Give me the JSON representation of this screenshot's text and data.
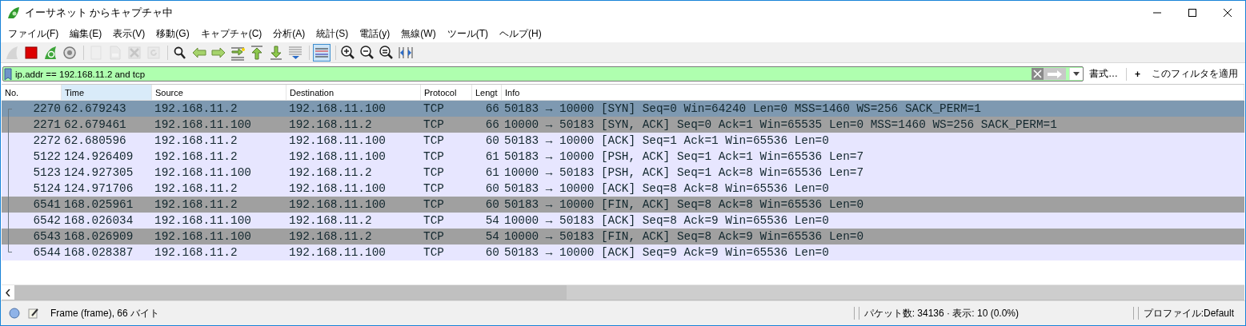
{
  "window": {
    "title": "イーサネット からキャプチャ中"
  },
  "menu": [
    "ファイル(F)",
    "編集(E)",
    "表示(V)",
    "移動(G)",
    "キャプチャ(C)",
    "分析(A)",
    "統計(S)",
    "電話(y)",
    "無線(W)",
    "ツール(T)",
    "ヘルプ(H)"
  ],
  "toolbar": [
    {
      "kind": "start",
      "disabled": true,
      "on": false
    },
    {
      "kind": "stop",
      "disabled": false,
      "on": false
    },
    {
      "kind": "restart",
      "disabled": false,
      "on": false
    },
    {
      "kind": "options",
      "disabled": false,
      "on": false
    },
    {
      "kind": "separator"
    },
    {
      "kind": "open",
      "disabled": true,
      "on": false
    },
    {
      "kind": "save",
      "disabled": true,
      "on": false
    },
    {
      "kind": "close",
      "disabled": true,
      "on": false
    },
    {
      "kind": "reload",
      "disabled": true,
      "on": false
    },
    {
      "kind": "separator"
    },
    {
      "kind": "find",
      "disabled": false,
      "on": false
    },
    {
      "kind": "back",
      "disabled": false,
      "on": false
    },
    {
      "kind": "forward",
      "disabled": false,
      "on": false
    },
    {
      "kind": "goto",
      "disabled": false,
      "on": false
    },
    {
      "kind": "first",
      "disabled": false,
      "on": false
    },
    {
      "kind": "last",
      "disabled": false,
      "on": false
    },
    {
      "kind": "autoscroll",
      "disabled": false,
      "on": false
    },
    {
      "kind": "separator"
    },
    {
      "kind": "colorize",
      "disabled": false,
      "on": true
    },
    {
      "kind": "separator"
    },
    {
      "kind": "zoom-in",
      "disabled": false,
      "on": false
    },
    {
      "kind": "zoom-out",
      "disabled": false,
      "on": false
    },
    {
      "kind": "zoom-normal",
      "disabled": false,
      "on": false
    },
    {
      "kind": "resize",
      "disabled": false,
      "on": false
    }
  ],
  "filter": {
    "value": "ip.addr == 192.168.11.2 and tcp",
    "format_button": "書式…",
    "add_button": "+",
    "apply_label": "このフィルタを適用"
  },
  "table": {
    "columns": [
      {
        "label": "No.",
        "sorted": false
      },
      {
        "label": "Time",
        "sorted": true
      },
      {
        "label": "Source",
        "sorted": false
      },
      {
        "label": "Destination",
        "sorted": false
      },
      {
        "label": "Protocol",
        "sorted": false
      },
      {
        "label": "Lengt",
        "sorted": false
      },
      {
        "label": "Info",
        "sorted": false
      }
    ],
    "rows": [
      {
        "cells": [
          "2270",
          "62.679243",
          "192.168.11.2",
          "192.168.11.100",
          "TCP",
          "66",
          "50183 → 10000 [SYN] Seq=0 Win=64240 Len=0 MSS=1460 WS=256 SACK_PERM=1"
        ],
        "selected": true
      },
      {
        "cells": [
          "2271",
          "62.679461",
          "192.168.11.100",
          "192.168.11.2",
          "TCP",
          "66",
          "10000 → 50183 [SYN, ACK] Seq=0 Ack=1 Win=65535 Len=0 MSS=1460 WS=256 SACK_PERM=1"
        ],
        "selected": false,
        "color": "#a0a0a0"
      },
      {
        "cells": [
          "2272",
          "62.680596",
          "192.168.11.2",
          "192.168.11.100",
          "TCP",
          "60",
          "50183 → 10000 [ACK] Seq=1 Ack=1 Win=65536 Len=0"
        ],
        "selected": false,
        "color": "#e7e6ff"
      },
      {
        "cells": [
          "5122",
          "124.926409",
          "192.168.11.2",
          "192.168.11.100",
          "TCP",
          "61",
          "50183 → 10000 [PSH, ACK] Seq=1 Ack=1 Win=65536 Len=7"
        ],
        "selected": false,
        "color": "#e7e6ff"
      },
      {
        "cells": [
          "5123",
          "124.927305",
          "192.168.11.100",
          "192.168.11.2",
          "TCP",
          "61",
          "10000 → 50183 [PSH, ACK] Seq=1 Ack=8 Win=65536 Len=7"
        ],
        "selected": false,
        "color": "#e7e6ff"
      },
      {
        "cells": [
          "5124",
          "124.971706",
          "192.168.11.2",
          "192.168.11.100",
          "TCP",
          "60",
          "50183 → 10000 [ACK] Seq=8 Ack=8 Win=65536 Len=0"
        ],
        "selected": false,
        "color": "#e7e6ff"
      },
      {
        "cells": [
          "6541",
          "168.025961",
          "192.168.11.2",
          "192.168.11.100",
          "TCP",
          "60",
          "50183 → 10000 [FIN, ACK] Seq=8 Ack=8 Win=65536 Len=0"
        ],
        "selected": false,
        "color": "#a0a0a0"
      },
      {
        "cells": [
          "6542",
          "168.026034",
          "192.168.11.100",
          "192.168.11.2",
          "TCP",
          "54",
          "10000 → 50183 [ACK] Seq=8 Ack=9 Win=65536 Len=0"
        ],
        "selected": false,
        "color": "#e7e6ff"
      },
      {
        "cells": [
          "6543",
          "168.026909",
          "192.168.11.100",
          "192.168.11.2",
          "TCP",
          "54",
          "10000 → 50183 [FIN, ACK] Seq=8 Ack=9 Win=65536 Len=0"
        ],
        "selected": false,
        "color": "#a0a0a0"
      },
      {
        "cells": [
          "6544",
          "168.028387",
          "192.168.11.2",
          "192.168.11.100",
          "TCP",
          "60",
          "50183 → 10000 [ACK] Seq=9 Ack=9 Win=65536 Len=0"
        ],
        "selected": false,
        "color": "#e7e6ff"
      }
    ]
  },
  "status_bar": {
    "frame": "Frame (frame), 66 バイト",
    "packets": "パケット数: 34136 · 表示: 10 (0.0%)",
    "profile": "プロファイル:Default"
  }
}
